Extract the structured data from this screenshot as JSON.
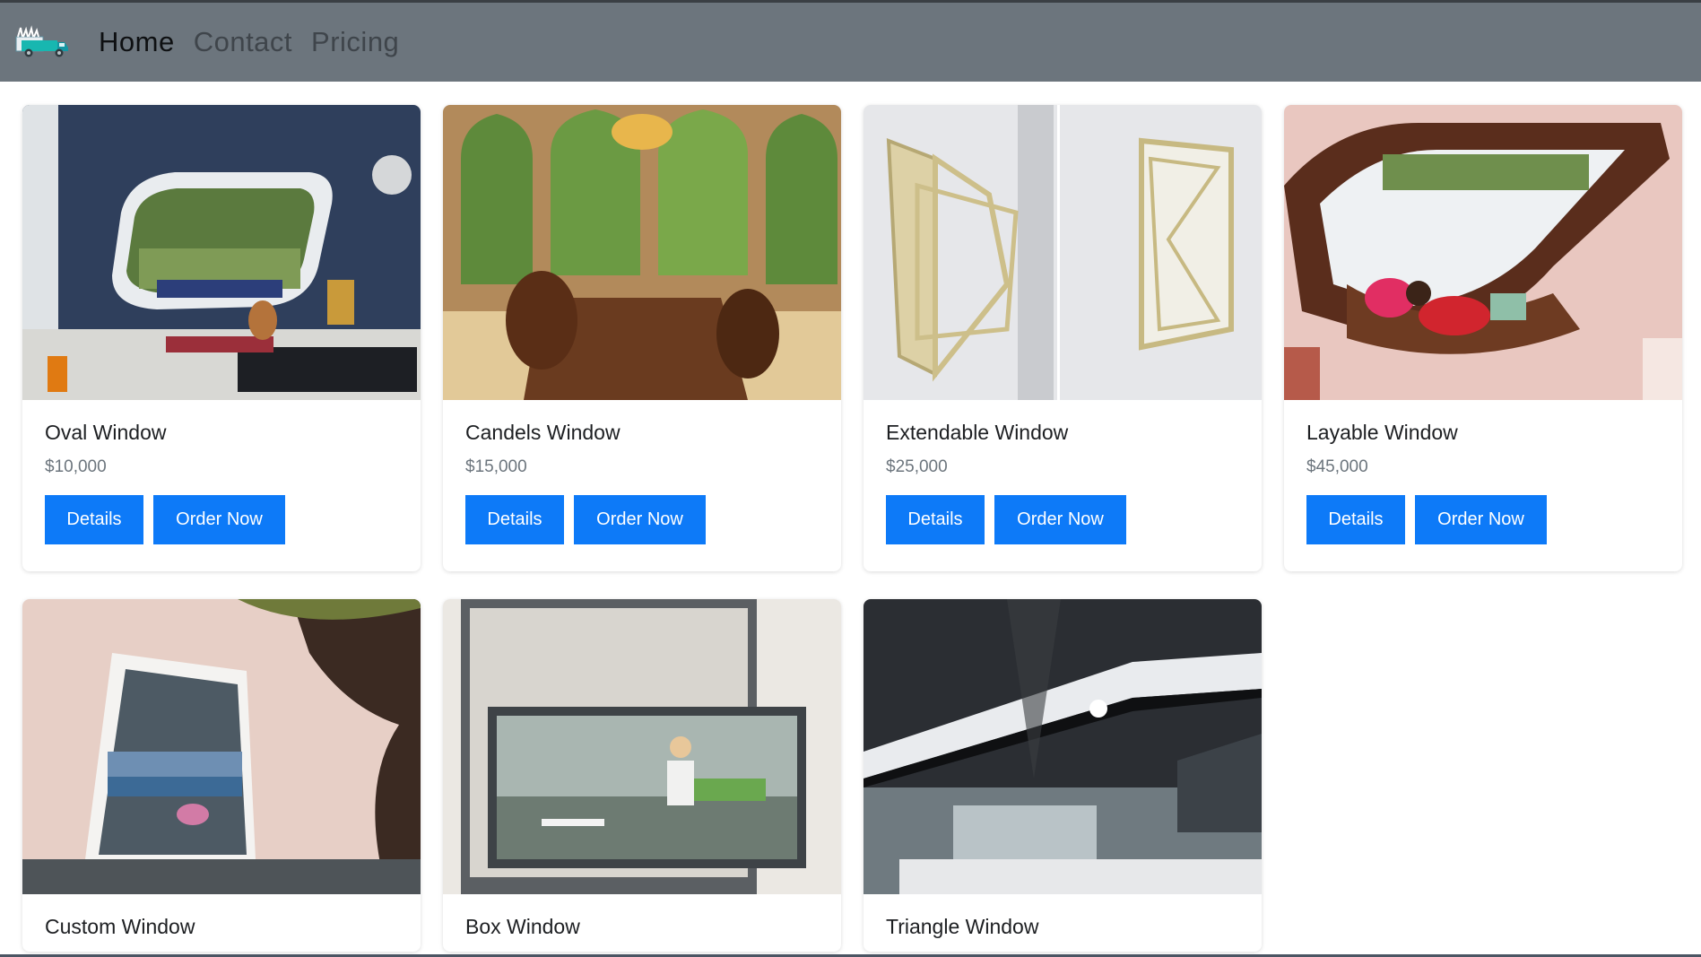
{
  "nav": {
    "logo_icon": "truck-icon",
    "links": [
      {
        "label": "Home",
        "active": true
      },
      {
        "label": "Contact",
        "active": false
      },
      {
        "label": "Pricing",
        "active": false
      }
    ]
  },
  "colors": {
    "navbar": "#6c757d",
    "button": "#0d7af8",
    "price": "#6c757d"
  },
  "products": [
    {
      "name": "Oval Window",
      "price": "$10,000",
      "details_label": "Details",
      "order_label": "Order Now",
      "image": "living-room-oval-window-image"
    },
    {
      "name": "Candels Window",
      "price": "$15,000",
      "details_label": "Details",
      "order_label": "Order Now",
      "image": "arched-dining-room-window-image"
    },
    {
      "name": "Extendable Window",
      "price": "$25,000",
      "details_label": "Details",
      "order_label": "Order Now",
      "image": "folding-extendable-window-image"
    },
    {
      "name": "Layable Window",
      "price": "$45,000",
      "details_label": "Details",
      "order_label": "Order Now",
      "image": "window-seat-reading-image"
    },
    {
      "name": "Custom Window",
      "image": "angled-modern-house-window-image"
    },
    {
      "name": "Box Window",
      "image": "cantilevered-box-window-image"
    },
    {
      "name": "Triangle Window",
      "image": "glass-house-exterior-image"
    }
  ]
}
